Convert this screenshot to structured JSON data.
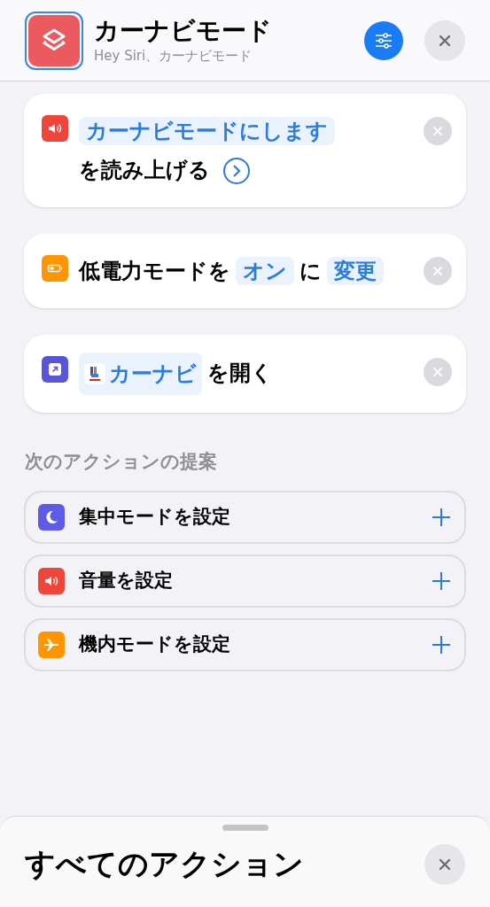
{
  "header": {
    "title": "カーナビモード",
    "subtitle": "Hey Siri、カーナビモード"
  },
  "actions": [
    {
      "kind": "speak",
      "color": "#f0453a",
      "parts": [
        {
          "kind": "token",
          "text": "カーナビモードにします"
        },
        {
          "kind": "text",
          "text": "を読み上げる"
        },
        {
          "kind": "chevron"
        }
      ]
    },
    {
      "kind": "low-power",
      "color": "#ff9500",
      "parts": [
        {
          "kind": "text",
          "text": "低電力モードを"
        },
        {
          "kind": "token",
          "text": "オン"
        },
        {
          "kind": "text",
          "text": "に"
        },
        {
          "kind": "token",
          "text": "変更"
        }
      ]
    },
    {
      "kind": "open-app",
      "color": "#5856d6",
      "parts": [
        {
          "kind": "app-token",
          "text": "カーナビ"
        },
        {
          "kind": "text",
          "text": "を開く"
        }
      ]
    }
  ],
  "suggestions_title": "次のアクションの提案",
  "suggestions": [
    {
      "kind": "focus",
      "color": "#5e5ce6",
      "label": "集中モードを設定"
    },
    {
      "kind": "volume",
      "color": "#f0453a",
      "label": "音量を設定"
    },
    {
      "kind": "airplane",
      "color": "#ff9500",
      "label": "機内モードを設定"
    }
  ],
  "sheet": {
    "title": "すべてのアクション"
  }
}
